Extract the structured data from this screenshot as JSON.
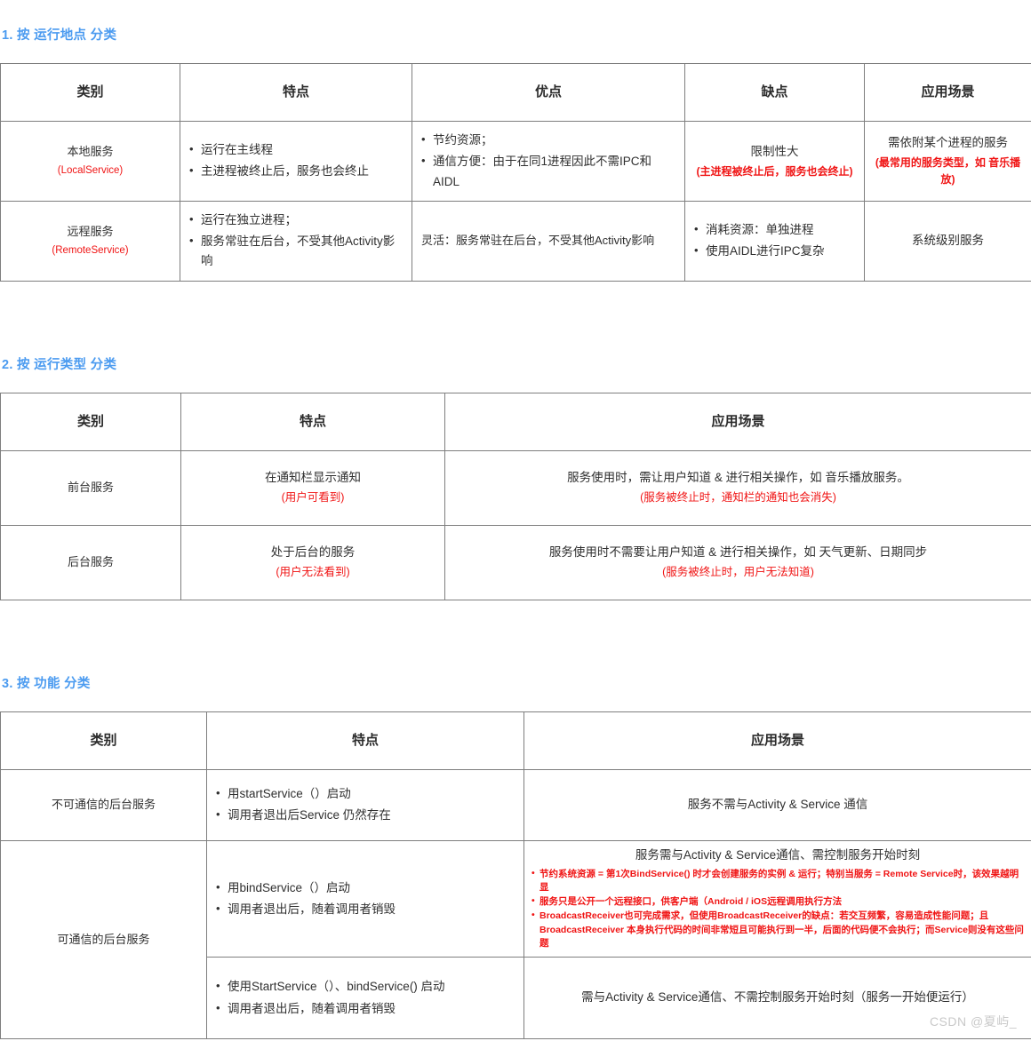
{
  "sections": [
    {
      "heading": "1. 按 运行地点 分类",
      "headers": [
        "类别",
        "特点",
        "优点",
        "缺点",
        "应用场景"
      ],
      "rows": [
        {
          "category": "本地服务",
          "category_en": "(LocalService)",
          "features": [
            "运行在主线程",
            "主进程被终止后，服务也会终止"
          ],
          "pros": [
            "节约资源；",
            "通信方便：由于在同1进程因此不需IPC和AIDL"
          ],
          "cons_title": "限制性大",
          "cons_note": "(主进程被终止后，服务也会终止)",
          "scene_title": "需依附某个进程的服务",
          "scene_note": "(最常用的服务类型，如 音乐播放)"
        },
        {
          "category": "远程服务",
          "category_en": "(RemoteService)",
          "features": [
            "运行在独立进程；",
            "服务常驻在后台，不受其他Activity影响"
          ],
          "pros_text": "灵活：服务常驻在后台，不受其他Activity影响",
          "cons": [
            "消耗资源：单独进程",
            "使用AIDL进行IPC复杂"
          ],
          "scene_title": "系统级别服务"
        }
      ]
    },
    {
      "heading": "2. 按 运行类型 分类",
      "headers": [
        "类别",
        "特点",
        "应用场景"
      ],
      "rows": [
        {
          "category": "前台服务",
          "feature_title": "在通知栏显示通知",
          "feature_note": "(用户可看到)",
          "scene_title": "服务使用时，需让用户知道 & 进行相关操作，如 音乐播放服务。",
          "scene_note": "(服务被终止时，通知栏的通知也会消失)"
        },
        {
          "category": "后台服务",
          "feature_title": "处于后台的服务",
          "feature_note": "(用户无法看到)",
          "scene_title": "服务使用时不需要让用户知道 & 进行相关操作，如 天气更新、日期同步",
          "scene_note": "(服务被终止时，用户无法知道)"
        }
      ]
    },
    {
      "heading": "3. 按 功能 分类",
      "headers": [
        "类别",
        "特点",
        "应用场景"
      ],
      "rows": [
        {
          "category": "不可通信的后台服务",
          "features": [
            "用startService（）启动",
            "调用者退出后Service 仍然存在"
          ],
          "scene_title": "服务不需与Activity & Service 通信"
        },
        {
          "category": "可通信的后台服务",
          "features": [
            "用bindService（）启动",
            "调用者退出后，随着调用者销毁"
          ],
          "scene_title": "服务需与Activity & Service通信、需控制服务开始时刻",
          "scene_bullets": [
            "节约系统资源 = 第1次BindService() 时才会创建服务的实例 & 运行；特别当服务 = Remote Service时，该效果越明显",
            "服务只是公开一个远程接口，供客户端（Android / iOS远程调用执行方法",
            "BroadcastReceiver也可完成需求，但使用BroadcastReceiver的缺点：若交互频繁，容易造成性能问题；且 BroadcastReceiver 本身执行代码的时间非常短且可能执行到一半，后面的代码便不会执行；而Service则没有这些问题"
          ]
        },
        {
          "features": [
            "使用StartService（）、bindService() 启动",
            "调用者退出后，随着调用者销毁"
          ],
          "scene_title": "需与Activity & Service通信、不需控制服务开始时刻（服务一开始便运行）"
        }
      ]
    }
  ],
  "watermark": "CSDN @夏屿_",
  "colors": {
    "heading": "#4b9bf0",
    "red": "#f01414",
    "border": "#7e7e7e"
  }
}
